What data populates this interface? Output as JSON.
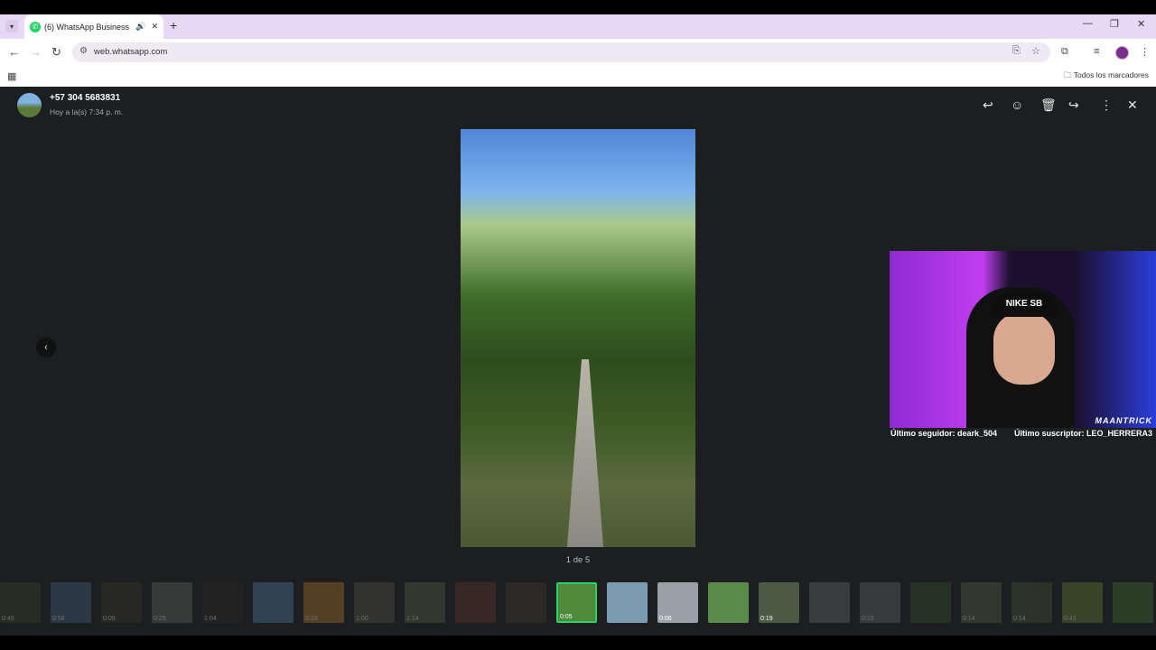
{
  "browser": {
    "tab_title": "(6) WhatsApp Business",
    "tab_audio_icon": "speaker-icon",
    "new_tab": "+",
    "url": "web.whatsapp.com",
    "bookmarks_label": "Todos los marcadores"
  },
  "header": {
    "contact": "+57 304 5683831",
    "timestamp": "Hoy a la(s) 7:34 p. m."
  },
  "viewer": {
    "counter": "1 de 5"
  },
  "overlay": {
    "cap_text": "NIKE SB",
    "brand": "MAANTRICK",
    "last_follower": "Último seguidor: deark_504",
    "last_subscriber": "Último suscriptor: LEO_HERRERA3"
  },
  "thumbnails": [
    {
      "duration": "0:49",
      "color": "#3a4a2e",
      "active": false,
      "dim": true
    },
    {
      "duration": "0:58",
      "color": "#4a6a8a",
      "active": false,
      "dim": true
    },
    {
      "duration": "0:09",
      "color": "#3c3a30",
      "active": false,
      "dim": true
    },
    {
      "duration": "0:29",
      "color": "#6a6e6a",
      "active": false,
      "dim": true
    },
    {
      "duration": "1:04",
      "color": "#2a2c26",
      "active": false,
      "dim": true
    },
    {
      "duration": "",
      "color": "#5a8ab0",
      "active": false,
      "dim": true
    },
    {
      "duration": "0:23",
      "color": "#c08030",
      "active": false,
      "dim": true
    },
    {
      "duration": "1:00",
      "color": "#5a5a50",
      "active": false,
      "dim": true
    },
    {
      "duration": "1:14",
      "color": "#5a6a4a",
      "active": false,
      "dim": true
    },
    {
      "duration": "",
      "color": "#6a3a2a",
      "active": false,
      "dim": true
    },
    {
      "duration": "",
      "color": "#4a4038",
      "active": false,
      "dim": true
    },
    {
      "duration": "0:05",
      "color": "#4f8a3a",
      "active": true,
      "dim": false
    },
    {
      "duration": "",
      "color": "#7a9ab0",
      "active": false,
      "dim": false
    },
    {
      "duration": "0:06",
      "color": "#9aa0a6",
      "active": false,
      "dim": false
    },
    {
      "duration": "",
      "color": "#5a8a4a",
      "active": false,
      "dim": false
    },
    {
      "duration": "0:19",
      "color": "#4a5a44",
      "active": false,
      "dim": false
    },
    {
      "duration": "",
      "color": "#707478",
      "active": false,
      "dim": true
    },
    {
      "duration": "0:15",
      "color": "#6a6e70",
      "active": false,
      "dim": true
    },
    {
      "duration": "",
      "color": "#3a5a2a",
      "active": false,
      "dim": true
    },
    {
      "duration": "0:14",
      "color": "#5a6a4a",
      "active": false,
      "dim": true
    },
    {
      "duration": "0:14",
      "color": "#4a5a3a",
      "active": false,
      "dim": true
    },
    {
      "duration": "0:43",
      "color": "#6a8a3a",
      "active": false,
      "dim": true
    },
    {
      "duration": "",
      "color": "#4a7a3a",
      "active": false,
      "dim": true
    }
  ]
}
